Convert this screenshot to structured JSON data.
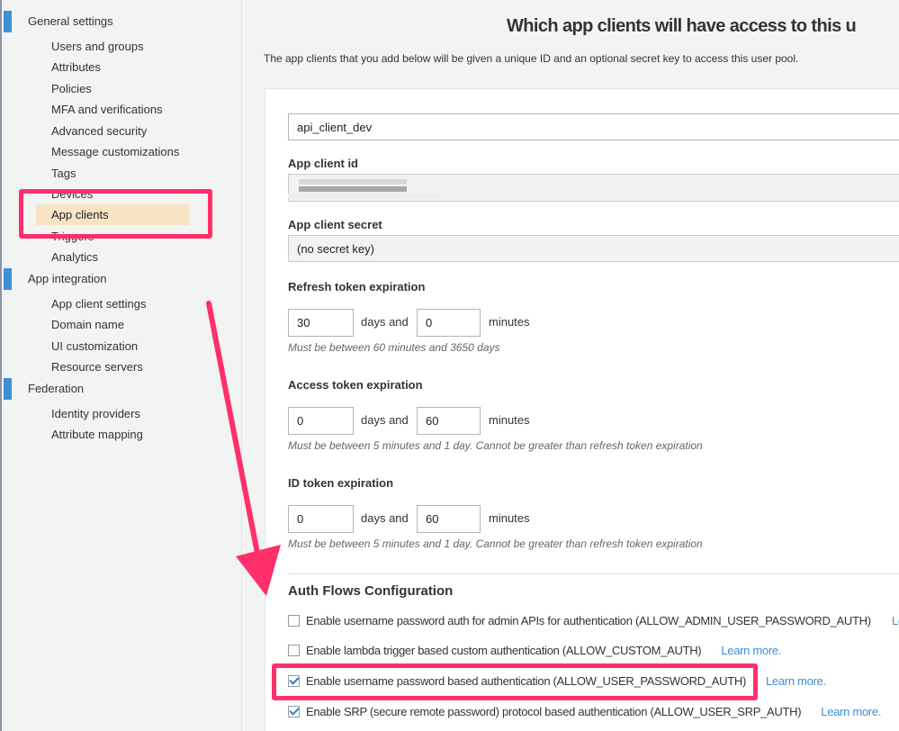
{
  "sidebar": {
    "groups": [
      {
        "label": "General settings",
        "items": [
          "Users and groups",
          "Attributes",
          "Policies",
          "MFA and verifications",
          "Advanced security",
          "Message customizations",
          "Tags",
          "Devices",
          "App clients",
          "Triggers",
          "Analytics"
        ]
      },
      {
        "label": "App integration",
        "items": [
          "App client settings",
          "Domain name",
          "UI customization",
          "Resource servers"
        ]
      },
      {
        "label": "Federation",
        "items": [
          "Identity providers",
          "Attribute mapping"
        ]
      }
    ],
    "active_item": "App clients"
  },
  "main": {
    "title": "Which app clients will have access to this u",
    "intro": "The app clients that you add below will be given a unique ID and an optional secret key to access this user pool.",
    "client_name": "api_client_dev",
    "client_id_label": "App client id",
    "client_secret_label": "App client secret",
    "client_secret_value": "(no secret key)",
    "days_and": "days and",
    "minutes": "minutes",
    "refresh": {
      "label": "Refresh token expiration",
      "days": "30",
      "minutes": "0",
      "hint": "Must be between 60 minutes and 3650 days"
    },
    "access": {
      "label": "Access token expiration",
      "days": "0",
      "minutes": "60",
      "hint": "Must be between 5 minutes and 1 day. Cannot be greater than refresh token expiration"
    },
    "idtoken": {
      "label": "ID token expiration",
      "days": "0",
      "minutes": "60",
      "hint": "Must be between 5 minutes and 1 day. Cannot be greater than refresh token expiration"
    },
    "auth_flows": {
      "heading": "Auth Flows Configuration",
      "options": [
        {
          "label": "Enable username password auth for admin APIs for authentication (ALLOW_ADMIN_USER_PASSWORD_AUTH)",
          "checked": false,
          "link": "Learn more."
        },
        {
          "label": "Enable lambda trigger based custom authentication (ALLOW_CUSTOM_AUTH)",
          "checked": false,
          "link": "Learn more."
        },
        {
          "label": "Enable username password based authentication (ALLOW_USER_PASSWORD_AUTH)",
          "checked": true,
          "link": "Learn more."
        },
        {
          "label": "Enable SRP (secure remote password) protocol based authentication (ALLOW_USER_SRP_AUTH)",
          "checked": true,
          "link": "Learn more."
        }
      ]
    }
  },
  "colors": {
    "accent": "#3f8fd2",
    "annotation": "#ff2f6b",
    "active_bg": "#f7e4c5",
    "link": "#3b8fd6"
  }
}
